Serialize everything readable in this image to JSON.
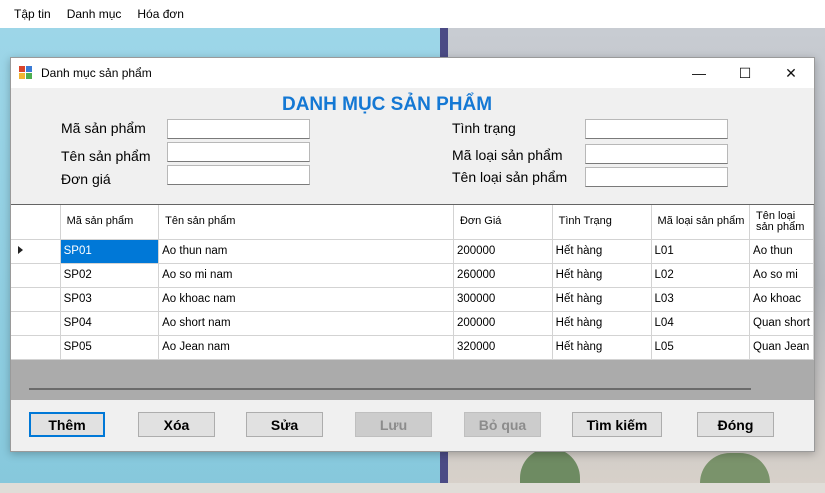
{
  "menubar": {
    "items": [
      "Tập tin",
      "Danh mục",
      "Hóa đơn"
    ]
  },
  "window": {
    "title": "Danh mục sản phẩm",
    "minimize": "—",
    "maximize": "☐",
    "close": "✕"
  },
  "form": {
    "heading": "DANH MỤC SẢN PHẨM",
    "labels": {
      "ma_san_pham": "Mã sản phẩm",
      "ten_san_pham": "Tên sản phẩm",
      "don_gia": "Đơn giá",
      "tinh_trang": "Tình trạng",
      "ma_loai_san_pham": "Mã loại sản phẩm",
      "ten_loai_san_pham": "Tên loại sản phẩm"
    },
    "values": {
      "ma_san_pham": "",
      "ten_san_pham": "",
      "don_gia": "",
      "tinh_trang": "",
      "ma_loai_san_pham": "",
      "ten_loai_san_pham": ""
    }
  },
  "grid": {
    "columns": [
      "Mã sản phẩm",
      "Tên sản phẩm",
      "Đơn Giá",
      "Tình Trạng",
      "Mã loại sản phẩm",
      "Tên loại sản phẩm"
    ],
    "rows": [
      [
        "SP01",
        "Ao thun nam",
        "200000",
        "Hết hàng",
        "L01",
        "Ao thun"
      ],
      [
        "SP02",
        "Ao so mi nam",
        "260000",
        "Hết hàng",
        "L02",
        "Ao so mi"
      ],
      [
        "SP03",
        "Ao khoac nam",
        "300000",
        "Hết hàng",
        "L03",
        "Ao khoac"
      ],
      [
        "SP04",
        "Ao short nam",
        "200000",
        "Hết hàng",
        "L04",
        "Quan short"
      ],
      [
        "SP05",
        "Ao Jean nam",
        "320000",
        "Hết hàng",
        "L05",
        "Quan Jean"
      ]
    ],
    "selected_row": 0
  },
  "buttons": {
    "them": "Thêm",
    "xoa": "Xóa",
    "sua": "Sửa",
    "luu": "Lưu",
    "bo_qua": "Bỏ qua",
    "tim_kiem": "Tìm kiếm",
    "dong": "Đóng"
  },
  "colors": {
    "heading": "#1478d4",
    "selection": "#0078d7"
  }
}
